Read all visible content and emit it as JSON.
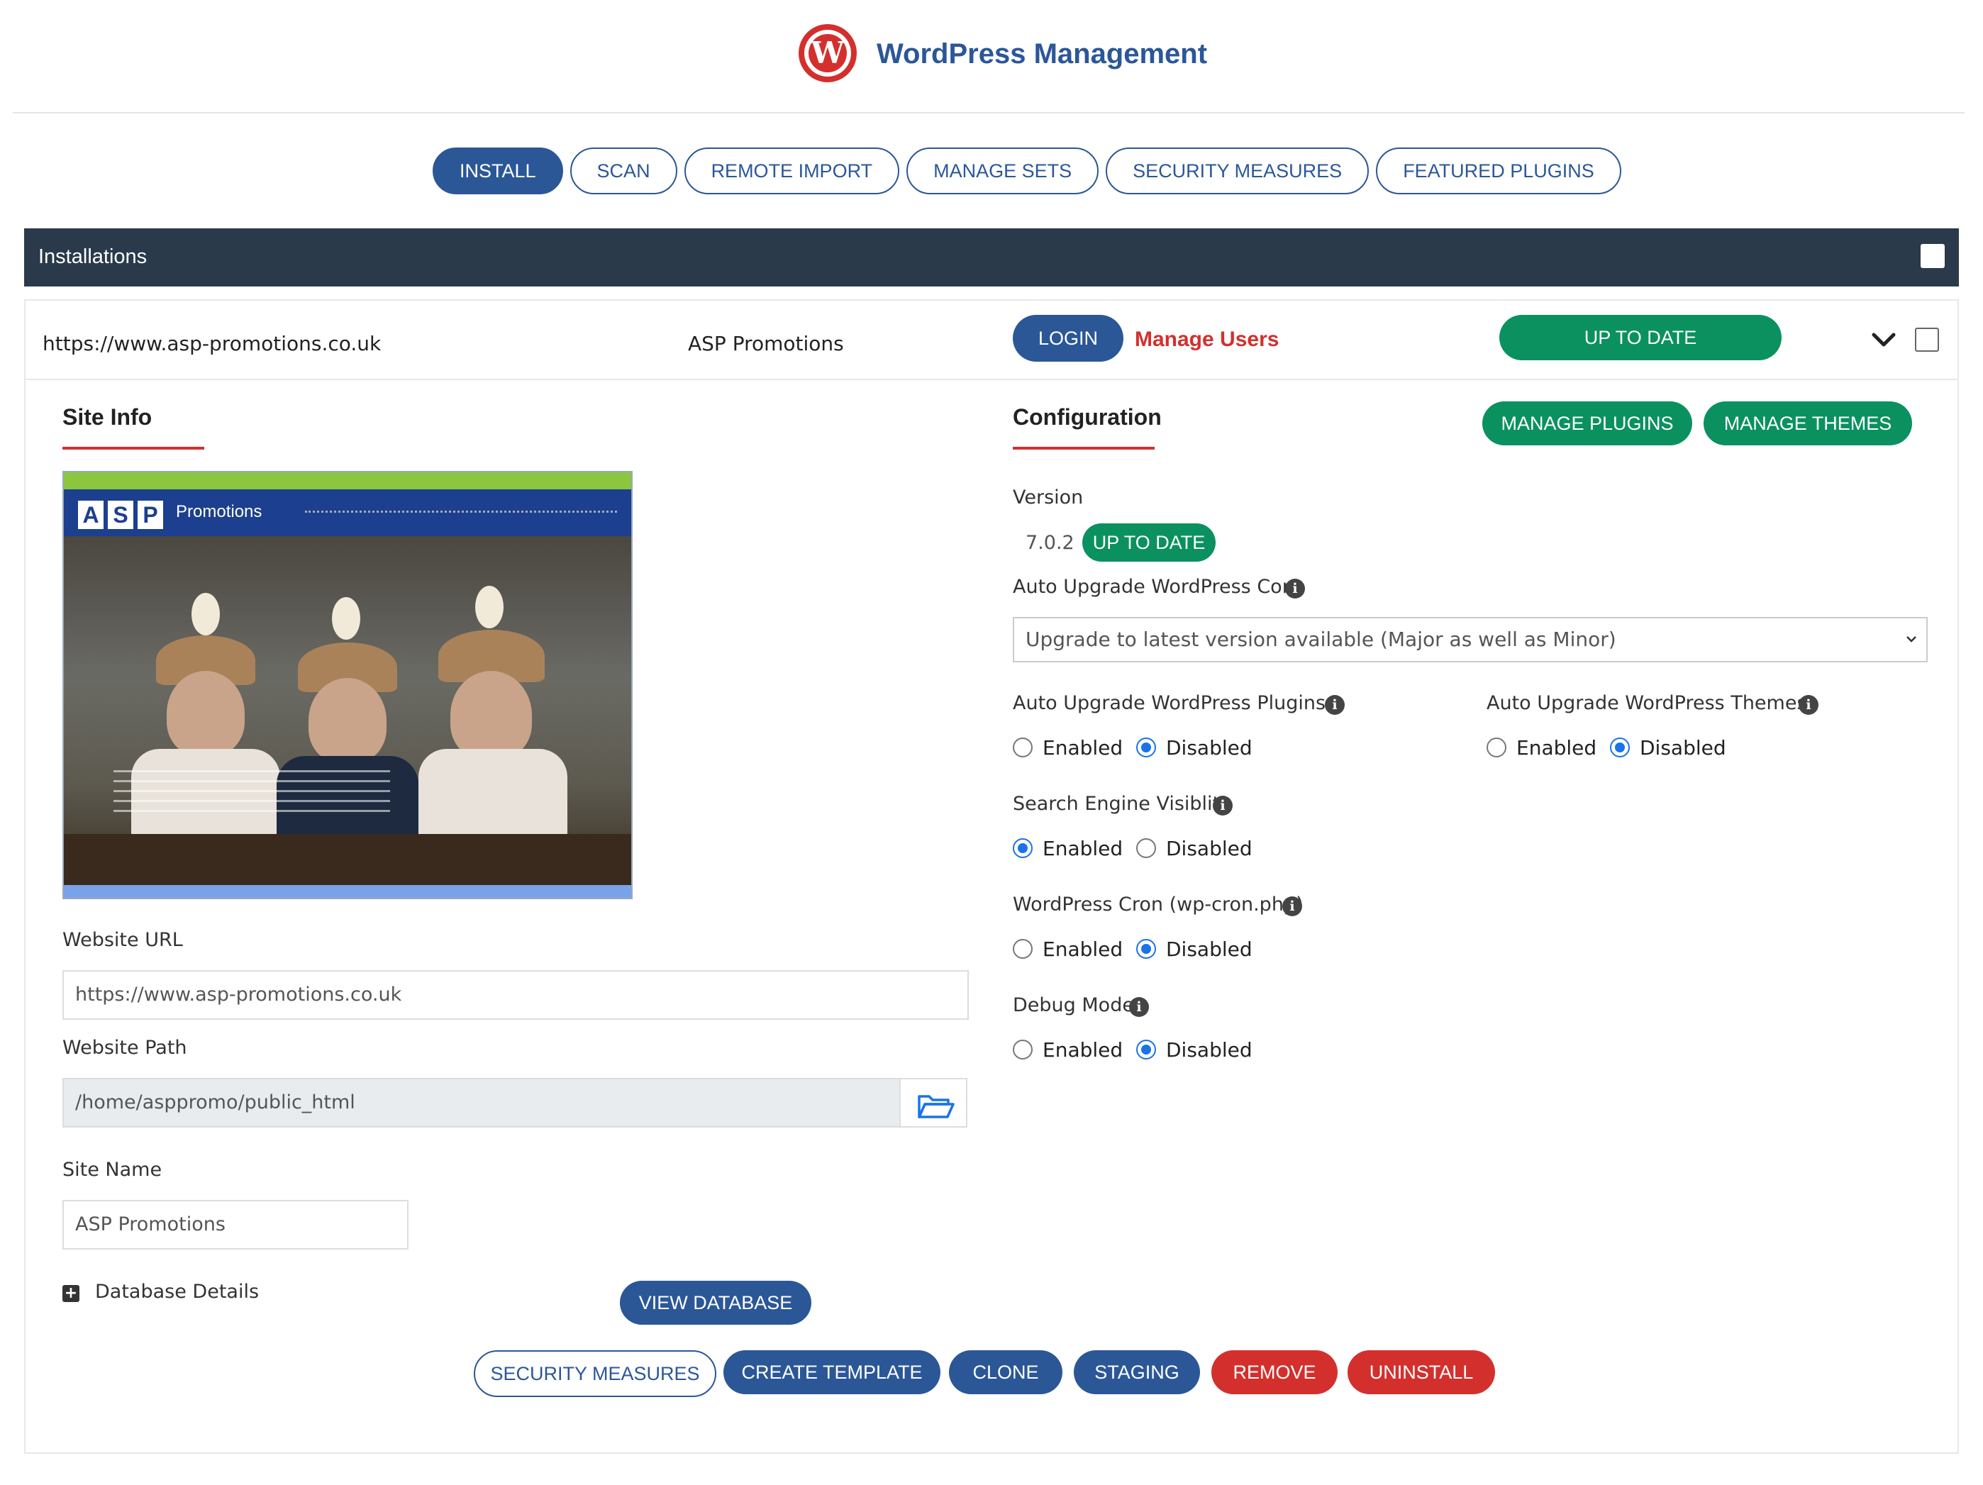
{
  "header": {
    "title": "WordPress Management",
    "logo": "wordpress-logo"
  },
  "tabs": [
    "INSTALL",
    "SCAN",
    "REMOTE IMPORT",
    "MANAGE SETS",
    "SECURITY MEASURES",
    "FEATURED PLUGINS"
  ],
  "active_tab": "INSTALL",
  "installations": {
    "title": "Installations",
    "row": {
      "url": "https://www.asp-promotions.co.uk",
      "name": "ASP Promotions",
      "login": "LOGIN",
      "manage_users": "Manage Users",
      "status": "UP TO DATE"
    }
  },
  "site_info": {
    "title": "Site Info",
    "screenshot": {
      "logo_letters": [
        "A",
        "S",
        "P"
      ],
      "brand": "Promotions"
    },
    "website_url_label": "Website URL",
    "website_url_value": "https://www.asp-promotions.co.uk",
    "website_path_label": "Website Path",
    "website_path_value": "/home/asppromo/public_html",
    "site_name_label": "Site Name",
    "site_name_value": "ASP Promotions",
    "database_details": "Database Details",
    "view_database": "VIEW DATABASE"
  },
  "configuration": {
    "title": "Configuration",
    "manage_plugins": "MANAGE PLUGINS",
    "manage_themes": "MANAGE THEMES",
    "version_label": "Version",
    "version_value": "7.0.2",
    "version_status": "UP TO DATE",
    "auto_core_label": "Auto Upgrade WordPress Core",
    "auto_core_value": "Upgrade to latest version available (Major as well as Minor)",
    "auto_plugins_label": "Auto Upgrade WordPress Plugins",
    "auto_themes_label": "Auto Upgrade WordPress Themes",
    "search_engine_label": "Search Engine Visiblity",
    "cron_label": "WordPress Cron (wp-cron.php)",
    "debug_label": "Debug Mode",
    "enabled": "Enabled",
    "disabled": "Disabled",
    "settings": {
      "auto_plugins": "Disabled",
      "auto_themes": "Disabled",
      "search_engine": "Enabled",
      "cron": "Disabled",
      "debug": "Disabled"
    }
  },
  "actions": [
    "SECURITY MEASURES",
    "CREATE TEMPLATE",
    "CLONE",
    "STAGING",
    "REMOVE",
    "UNINSTALL"
  ],
  "colors": {
    "brand_blue": "#2b5797",
    "green": "#0b9160",
    "red": "#d3302d",
    "dark_bar": "#2a3a4b",
    "radio_blue": "#1a73e8"
  }
}
